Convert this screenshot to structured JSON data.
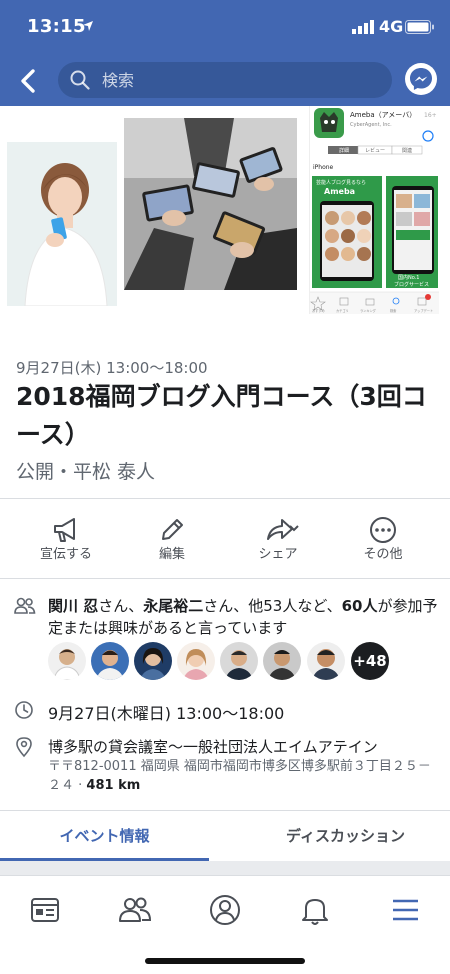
{
  "status_bar": {
    "time": "13:15",
    "network": "4G"
  },
  "search": {
    "placeholder": "検索"
  },
  "event": {
    "date_time_small": "9月27日(木) 13:00〜18:00",
    "title": "2018福岡ブログ入門コース（3回コース）",
    "host": "公開・平松 泰人"
  },
  "cover": {
    "app_name": "Ameba（アメーバ）",
    "app_dev": "CyberAgent, Inc.",
    "app_age": "16+",
    "tab_details": "詳細",
    "tab_reviews": "レビュー",
    "tab_related": "関連",
    "platform": "iPhone",
    "screenshot_caption_1": "芸能人ブログ見るなら",
    "screenshot_caption_2": "Ameba",
    "screenshot_caption_3": "国内No.1",
    "screenshot_caption_4": "ブログサービス",
    "tabbar": [
      "おすすめ",
      "カテゴリ",
      "ランキング",
      "検索",
      "アップデート"
    ]
  },
  "actions": [
    {
      "label": "宣伝する",
      "icon": "megaphone-icon"
    },
    {
      "label": "編集",
      "icon": "pencil-icon"
    },
    {
      "label": "シェア",
      "icon": "share-icon"
    },
    {
      "label": "その他",
      "icon": "more-icon"
    }
  ],
  "going": {
    "name1": "関川 忍",
    "sep1": "さん、",
    "name2": "永尾裕二",
    "sep2": "さん、他53人など、",
    "count": "60人",
    "rest": "が参加予定または興味があると言っています",
    "more_avatars": "+48"
  },
  "details": {
    "time": "9月27日(木曜日) 13:00〜18:00",
    "place": "博多駅の貸会議室〜一般社団法人エイムアテイン",
    "address": "〒〒812-0011 福岡県 福岡市福岡市博多区博多駅前３丁目２５－２４ · ",
    "distance": "481 km"
  },
  "tabs": {
    "active": "イベント情報",
    "other": "ディスカッション"
  },
  "bottom_nav": [
    "news-feed-icon",
    "friends-icon",
    "profile-icon",
    "notifications-icon",
    "menu-icon"
  ],
  "colors": {
    "brand": "#4267b2",
    "search_bg": "#365899",
    "text_secondary": "#606770"
  }
}
